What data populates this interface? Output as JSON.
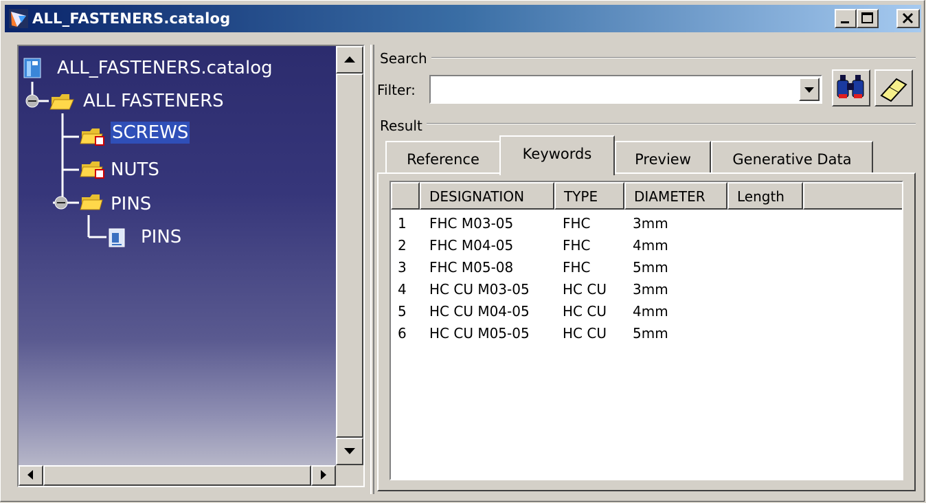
{
  "window": {
    "title": "ALL_FASTENERS.catalog"
  },
  "tree": {
    "root": "ALL_FASTENERS.catalog",
    "nodes": [
      "ALL FASTENERS",
      "SCREWS",
      "NUTS",
      "PINS",
      "PINS"
    ]
  },
  "search": {
    "group_label": "Search",
    "filter_label": "Filter:",
    "filter_value": ""
  },
  "result": {
    "group_label": "Result",
    "tabs": [
      "Reference",
      "Keywords",
      "Preview",
      "Generative Data"
    ],
    "active_tab": "Keywords",
    "columns": [
      "DESIGNATION",
      "TYPE",
      "DIAMETER",
      "Length"
    ],
    "rows": [
      [
        "1",
        "FHC M03-05",
        "FHC",
        "3mm"
      ],
      [
        "2",
        "FHC M04-05",
        "FHC",
        "4mm"
      ],
      [
        "3",
        "FHC M05-08",
        "FHC",
        "5mm"
      ],
      [
        "4",
        "HC CU M03-05",
        "HC CU",
        "3mm"
      ],
      [
        "5",
        "HC CU M04-05",
        "HC CU",
        "4mm"
      ],
      [
        "6",
        "HC CU M05-05",
        "HC CU",
        "5mm"
      ]
    ]
  },
  "icons": {
    "title": "catalog-app-icon",
    "minimize": "minimize-icon",
    "maximize": "maximize-icon",
    "close": "close-icon",
    "search_button": "binoculars-icon",
    "clear_button": "eraser-icon"
  },
  "colors": {
    "title_gradient_start": "#0a246a",
    "title_gradient_end": "#a6caf0",
    "tree_background": "#2c2c6e",
    "selection": "#2f4fb8"
  }
}
